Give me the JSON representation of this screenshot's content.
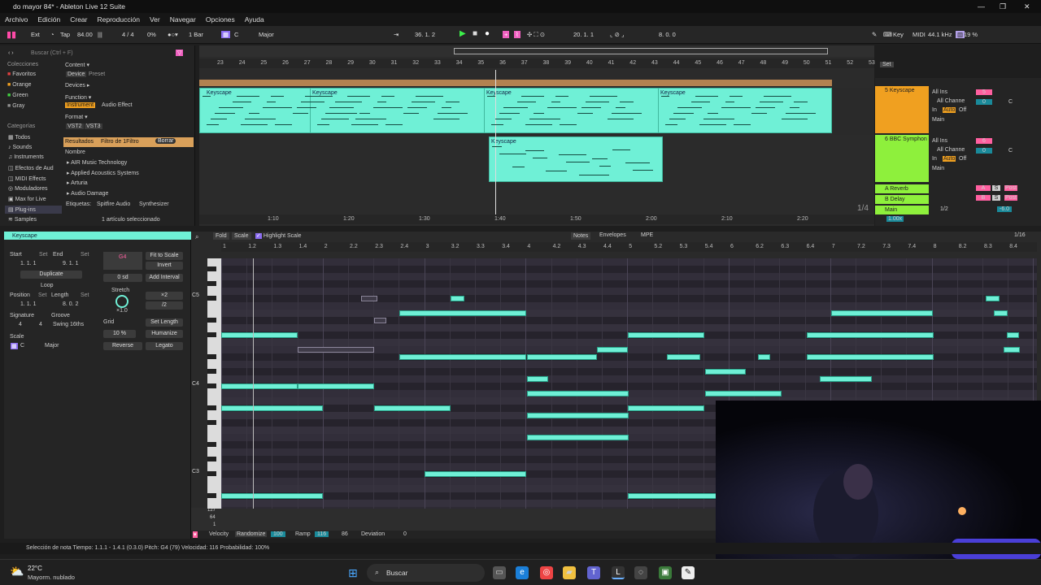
{
  "window": {
    "title": "do mayor  84* - Ableton Live 12 Suite"
  },
  "menu": [
    "Archivo",
    "Edición",
    "Crear",
    "Reproducción",
    "Ver",
    "Navegar",
    "Opciones",
    "Ayuda"
  ],
  "control": {
    "ext": "Ext",
    "tap": "Tap",
    "tempo": "84.00",
    "signature": "4 / 4",
    "percent": "0%",
    "quant": "1 Bar",
    "key": "C",
    "scale": "Major",
    "position": "36.  1.  2",
    "loop_start": "20.  1.  1",
    "loop_len": "8.  0.  0",
    "key_label": "Key",
    "midi_label": "MIDI",
    "sample_rate": "44.1 kHz",
    "cpu": "19 %"
  },
  "browser": {
    "search_placeholder": "Buscar (Ctrl + F)",
    "collections_title": "Colecciones",
    "collections": [
      "Favoritos",
      "Orange",
      "Green",
      "Gray"
    ],
    "collection_colors": [
      "#e04040",
      "#f0a020",
      "#40d040",
      "#909090"
    ],
    "categories_title": "Categorías",
    "categories": [
      "Todos",
      "Sounds",
      "Instruments",
      "Efectos de Aud",
      "MIDI Effects",
      "Moduladores",
      "Max for Live",
      "Plug-ins",
      "Samples"
    ],
    "content_label": "Content ▾",
    "device": "Device",
    "preset": "Preset",
    "devices_label": "Devices ▸",
    "function_label": "Function ▾",
    "instrument": "Instrument",
    "audio_effect": "Audio Effect",
    "format_label": "Format ▾",
    "vst2": "VST2",
    "vst3": "VST3",
    "results": "Resultados",
    "filter": "Filtro de 1Filtro",
    "borrar": "Borrar",
    "name_col": "Nombre",
    "vendors": [
      "AIR Music Technology",
      "Applied Acoustics Systems",
      "Arturia",
      "Audio Damage"
    ],
    "tags_label": "Etiquetas:",
    "tag1": "Spitfire Audio",
    "tag2": "Synthesizer",
    "selected_info": "1 artículo seleccionado"
  },
  "arrangement": {
    "bars": [
      "23",
      "24",
      "25",
      "26",
      "27",
      "28",
      "29",
      "30",
      "31",
      "32",
      "33",
      "34",
      "35",
      "36",
      "37",
      "38",
      "39",
      "40",
      "41",
      "42",
      "43",
      "44",
      "45",
      "46",
      "47",
      "48",
      "49",
      "50",
      "51",
      "52",
      "53"
    ],
    "clips": [
      "Keyscape",
      "Keyscape",
      "Keyscape",
      "Keyscape",
      "Keyscape"
    ],
    "times": [
      "1:10",
      "1:20",
      "1:30",
      "1:40",
      "1:50",
      "2:00",
      "2:10",
      "2:20"
    ],
    "set_label": "Set",
    "quant": "1/4"
  },
  "mixer": {
    "tracks": [
      {
        "name": "5 Keyscape",
        "input": "All Ins",
        "channel": "All Channe",
        "in": "In",
        "auto": "Auto",
        "off": "Off",
        "out": "Main",
        "num": "5",
        "vol": "0",
        "pan": "C",
        "color": "#f0a020"
      },
      {
        "name": "6 BBC Symphon",
        "input": "All Ins",
        "channel": "All Channe",
        "in": "In",
        "auto": "Auto",
        "off": "Off",
        "out": "Main",
        "num": "6",
        "vol": "0",
        "pan": "C",
        "color": "#8ef03c"
      }
    ],
    "returns": [
      "A Reverb",
      "B Delay"
    ],
    "return_letters": [
      "A",
      "B"
    ],
    "main": "Main",
    "main_ratio": "1/2",
    "main_vol": "-6.0",
    "tempo_ratio": "1.00x",
    "post": "Post",
    "S": "S"
  },
  "clip": {
    "name": "Keyscape",
    "start": "Start",
    "set": "Set",
    "end": "End",
    "start_val": "1.  1.  1",
    "end_val": "9.  1.  1",
    "duplicate": "Duplicate",
    "loop": "Loop",
    "position": "Position",
    "length": "Length",
    "pos_val": "1.  1.  1",
    "len_val": "8.  0.  2",
    "signature": "Signature",
    "groove": "Groove",
    "sig_num": "4",
    "sig_den": "4",
    "swing": "Swing 16ths",
    "scale": "Scale",
    "key": "C",
    "mode": "Major",
    "note": "G4",
    "fit": "Fit to Scale",
    "invert": "Invert",
    "semitone": "0 sd",
    "add_interval": "Add Interval",
    "stretch": "Stretch",
    "stretch_val": "×1.0",
    "x2": "×2",
    "div2": "/2",
    "grid": "Grid",
    "set_length": "Set Length",
    "humanize_pct": "10 %",
    "humanize": "Humanize",
    "reverse": "Reverse",
    "legato": "Legato"
  },
  "editor": {
    "fold": "Fold",
    "scale": "Scale",
    "highlight": "Highlight Scale",
    "tabs": [
      "Notes",
      "Envelopes",
      "MPE"
    ],
    "grid": "1/16",
    "ruler": [
      "1",
      "1.2",
      "1.3",
      "1.4",
      "2",
      "2.2",
      "2.3",
      "2.4",
      "3",
      "3.2",
      "3.3",
      "3.4",
      "4",
      "4.2",
      "4.3",
      "4.4",
      "5",
      "5.2",
      "5.3",
      "5.4",
      "6",
      "6.2",
      "6.3",
      "6.4",
      "7",
      "7.2",
      "7.3",
      "7.4",
      "8",
      "8.2",
      "8.3",
      "8.4"
    ],
    "pitch_labels": [
      "C5",
      "C4",
      "C3"
    ],
    "vel_ticks": [
      "127",
      "64",
      "1"
    ],
    "velocity": "Velocity",
    "randomize": "Randomize",
    "vel_val": "100",
    "ramp": "Ramp",
    "ramp_val": "116",
    "ramp2": "86",
    "deviation": "Deviation",
    "dev_val": "0"
  },
  "status": "Selección de nota   Tiempo: 1.1.1 - 1.4.1 (0.3.0)   Pitch: G4 (79)   Velocidad: 116   Probabilidad: 100%",
  "taskbar": {
    "temp": "22°C",
    "weather": "Mayorm. nublado",
    "search": "Buscar"
  }
}
